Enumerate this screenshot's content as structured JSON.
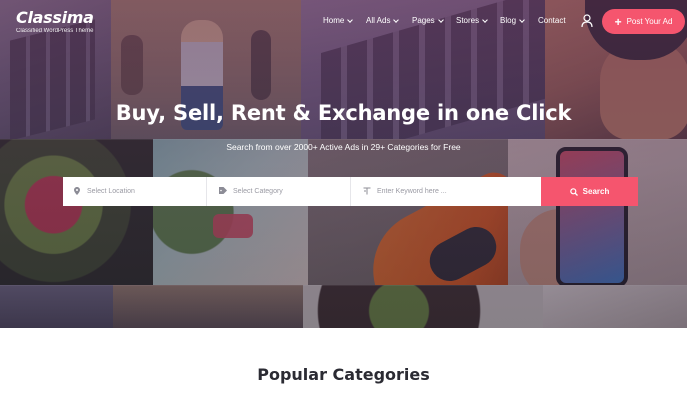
{
  "brand": {
    "name": "Classima",
    "tagline": "Classified WordPress Theme"
  },
  "nav": {
    "items": [
      {
        "label": "Home",
        "has_dropdown": true
      },
      {
        "label": "All Ads",
        "has_dropdown": true
      },
      {
        "label": "Pages",
        "has_dropdown": true
      },
      {
        "label": "Stores",
        "has_dropdown": true
      },
      {
        "label": "Blog",
        "has_dropdown": true
      },
      {
        "label": "Contact",
        "has_dropdown": false
      }
    ],
    "user_icon": "user-icon",
    "post_button": {
      "label": "Post Your Ad",
      "icon": "plus-icon"
    }
  },
  "hero": {
    "headline": "Buy, Sell, Rent & Exchange in one Click",
    "subline": "Search from over 2000+ Active Ads in 29+ Categories for Free"
  },
  "search": {
    "location_placeholder": "Select Location",
    "category_placeholder": "Select Category",
    "keyword_placeholder": "Enter Keyword here ...",
    "button_label": "Search",
    "icons": [
      "map-pin-icon",
      "tag-icon",
      "text-icon",
      "search-icon"
    ]
  },
  "section": {
    "title": "Popular Categories"
  },
  "colors": {
    "accent": "#f5556e",
    "overlay": "#58264b",
    "text_dark": "#2b2b33"
  }
}
